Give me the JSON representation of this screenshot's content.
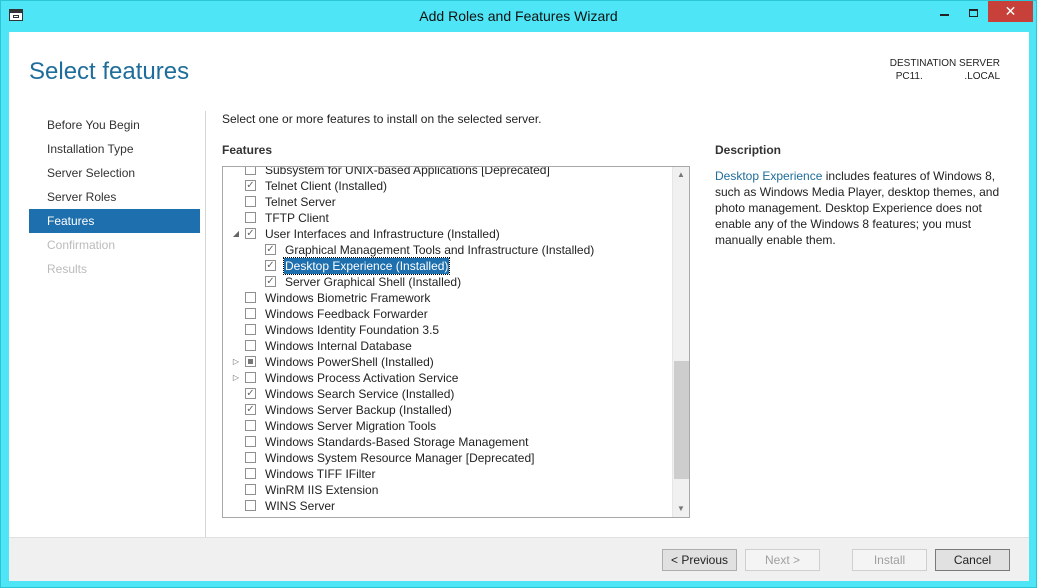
{
  "window": {
    "title": "Add Roles and Features Wizard",
    "close_glyph": "✕"
  },
  "page": {
    "heading": "Select features",
    "destination_label": "DESTINATION SERVER",
    "destination_server": "PC11.               .LOCAL",
    "instruction": "Select one or more features to install on the selected server.",
    "features_label": "Features",
    "description_label": "Description"
  },
  "steps": [
    {
      "label": "Before You Begin",
      "state": "normal"
    },
    {
      "label": "Installation Type",
      "state": "normal"
    },
    {
      "label": "Server Selection",
      "state": "normal"
    },
    {
      "label": "Server Roles",
      "state": "normal"
    },
    {
      "label": "Features",
      "state": "active"
    },
    {
      "label": "Confirmation",
      "state": "disabled"
    },
    {
      "label": "Results",
      "state": "disabled"
    }
  ],
  "features": [
    {
      "label": "Subsystem for UNIX-based Applications [Deprecated]",
      "level": 0,
      "checked": false,
      "expander": ""
    },
    {
      "label": "Telnet Client (Installed)",
      "level": 0,
      "checked": true,
      "expander": ""
    },
    {
      "label": "Telnet Server",
      "level": 0,
      "checked": false,
      "expander": ""
    },
    {
      "label": "TFTP Client",
      "level": 0,
      "checked": false,
      "expander": ""
    },
    {
      "label": "User Interfaces and Infrastructure (Installed)",
      "level": 0,
      "checked": true,
      "expander": "expanded"
    },
    {
      "label": "Graphical Management Tools and Infrastructure (Installed)",
      "level": 1,
      "checked": true,
      "expander": ""
    },
    {
      "label": "Desktop Experience (Installed)",
      "level": 1,
      "checked": true,
      "expander": "",
      "selected": true
    },
    {
      "label": "Server Graphical Shell (Installed)",
      "level": 1,
      "checked": true,
      "expander": ""
    },
    {
      "label": "Windows Biometric Framework",
      "level": 0,
      "checked": false,
      "expander": ""
    },
    {
      "label": "Windows Feedback Forwarder",
      "level": 0,
      "checked": false,
      "expander": ""
    },
    {
      "label": "Windows Identity Foundation 3.5",
      "level": 0,
      "checked": false,
      "expander": ""
    },
    {
      "label": "Windows Internal Database",
      "level": 0,
      "checked": false,
      "expander": ""
    },
    {
      "label": "Windows PowerShell (Installed)",
      "level": 0,
      "checked": "partial",
      "expander": "collapsed"
    },
    {
      "label": "Windows Process Activation Service",
      "level": 0,
      "checked": false,
      "expander": "collapsed"
    },
    {
      "label": "Windows Search Service (Installed)",
      "level": 0,
      "checked": true,
      "expander": ""
    },
    {
      "label": "Windows Server Backup (Installed)",
      "level": 0,
      "checked": true,
      "expander": ""
    },
    {
      "label": "Windows Server Migration Tools",
      "level": 0,
      "checked": false,
      "expander": ""
    },
    {
      "label": "Windows Standards-Based Storage Management",
      "level": 0,
      "checked": false,
      "expander": ""
    },
    {
      "label": "Windows System Resource Manager [Deprecated]",
      "level": 0,
      "checked": false,
      "expander": ""
    },
    {
      "label": "Windows TIFF IFilter",
      "level": 0,
      "checked": false,
      "expander": ""
    },
    {
      "label": "WinRM IIS Extension",
      "level": 0,
      "checked": false,
      "expander": ""
    },
    {
      "label": "WINS Server",
      "level": 0,
      "checked": false,
      "expander": ""
    }
  ],
  "description": {
    "link": "Desktop Experience",
    "text": " includes features of Windows 8, such as Windows Media Player, desktop themes, and photo management. Desktop Experience does not enable any of the Windows 8 features; you must manually enable them."
  },
  "buttons": {
    "previous": "< Previous",
    "next": "Next >",
    "install": "Install",
    "cancel": "Cancel"
  }
}
